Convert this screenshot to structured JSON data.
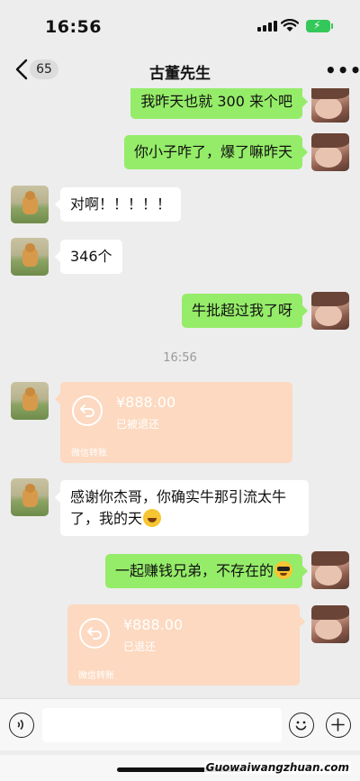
{
  "status_bar": {
    "time": "16:56",
    "battery_icon": "battery-charging-icon"
  },
  "nav": {
    "unread_count": "65",
    "title": "古董先生",
    "more_label": "•••"
  },
  "messages": [
    {
      "side": "out",
      "text": "我昨天也就 300 来个吧"
    },
    {
      "side": "out",
      "text": "你小子咋了，爆了嘛昨天"
    },
    {
      "side": "in",
      "text": "对啊！！！！！"
    },
    {
      "side": "in",
      "text": "346个"
    },
    {
      "side": "out",
      "text": "牛批超过我了呀"
    }
  ],
  "timestamp": "16:56",
  "transfer_in": {
    "amount": "¥888.00",
    "status": "已被退还",
    "footer": "微信转账"
  },
  "message_thanks": {
    "line1": "感谢你杰哥，你确实牛那引流太牛",
    "line2": "了，我的天",
    "emoji": "laughing-emoji"
  },
  "message_reply": {
    "text": "一起赚钱兄弟，不存在的",
    "emoji": "sunglasses-emoji"
  },
  "transfer_out": {
    "amount": "¥888.00",
    "status": "已退还",
    "footer": "微信转账"
  },
  "input_bar": {
    "voice_icon": "voice-icon",
    "emoji_icon": "emoji-icon",
    "plus_icon": "plus-icon",
    "placeholder": ""
  },
  "watermark": "Guowaiwangzhuan.com",
  "colors": {
    "outgoing_bubble": "#95ec69",
    "incoming_bubble": "#ffffff",
    "transfer_card": "#fcd9c0",
    "background": "#ededed"
  }
}
